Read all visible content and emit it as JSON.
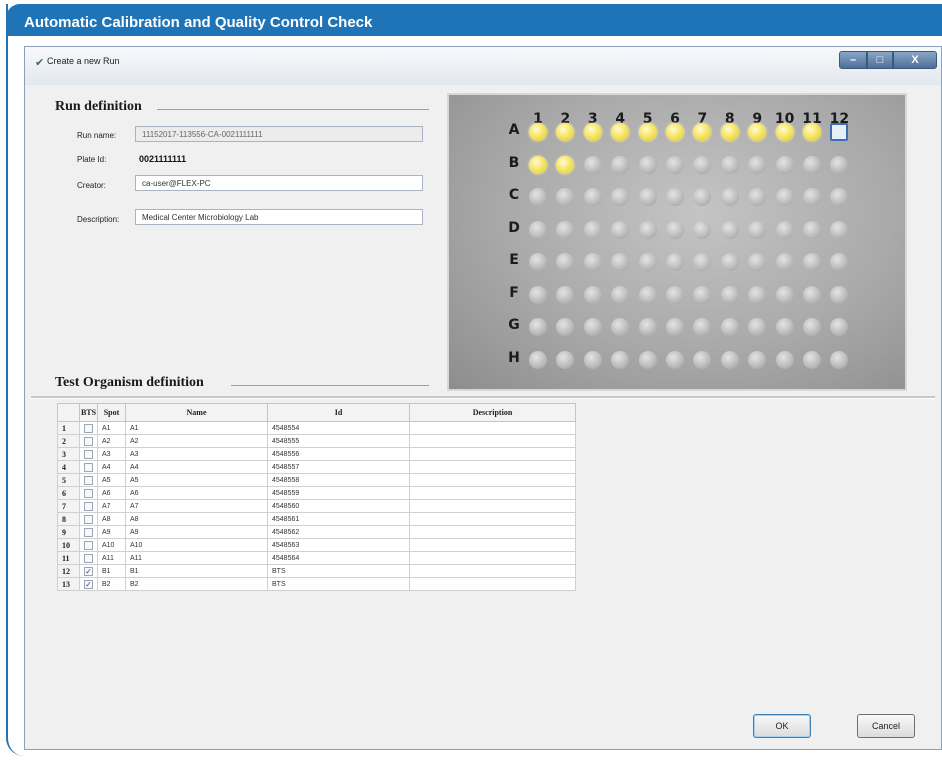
{
  "banner": {
    "title": "Automatic Calibration and Quality Control Check"
  },
  "window": {
    "title": "Create a new Run",
    "controls": {
      "minimize": "–",
      "maximize": "□",
      "close": "X"
    }
  },
  "run_definition": {
    "heading": "Run definition",
    "run_name_label": "Run name:",
    "run_name_value": "11152017-113556-CA-0021111111",
    "plate_id_label": "Plate Id:",
    "plate_id_value": "0021111111",
    "creator_label": "Creator:",
    "creator_value": "ca-user@FLEX-PC",
    "description_label": "Description:",
    "description_value": "Medical Center Microbiology Lab"
  },
  "plate": {
    "columns": [
      "1",
      "2",
      "3",
      "4",
      "5",
      "6",
      "7",
      "8",
      "9",
      "10",
      "11",
      "12"
    ],
    "rows": [
      "A",
      "B",
      "C",
      "D",
      "E",
      "F",
      "G",
      "H"
    ],
    "filled_wells": [
      "A1",
      "A2",
      "A3",
      "A4",
      "A5",
      "A6",
      "A7",
      "A8",
      "A9",
      "A10",
      "A11",
      "B1",
      "B2"
    ],
    "selected_well": "A12",
    "filled_color": "#f6e66a"
  },
  "organism_definition": {
    "heading": "Test Organism definition",
    "columns": {
      "bts": "BTS",
      "spot": "Spot",
      "name": "Name",
      "id": "Id",
      "description": "Description"
    },
    "rows": [
      {
        "num": "1",
        "bts": false,
        "spot": "A1",
        "name": "A1",
        "id": "4548554",
        "description": ""
      },
      {
        "num": "2",
        "bts": false,
        "spot": "A2",
        "name": "A2",
        "id": "4548555",
        "description": ""
      },
      {
        "num": "3",
        "bts": false,
        "spot": "A3",
        "name": "A3",
        "id": "4548556",
        "description": ""
      },
      {
        "num": "4",
        "bts": false,
        "spot": "A4",
        "name": "A4",
        "id": "4548557",
        "description": ""
      },
      {
        "num": "5",
        "bts": false,
        "spot": "A5",
        "name": "A5",
        "id": "4548558",
        "description": ""
      },
      {
        "num": "6",
        "bts": false,
        "spot": "A6",
        "name": "A6",
        "id": "4548559",
        "description": ""
      },
      {
        "num": "7",
        "bts": false,
        "spot": "A7",
        "name": "A7",
        "id": "4548560",
        "description": ""
      },
      {
        "num": "8",
        "bts": false,
        "spot": "A8",
        "name": "A8",
        "id": "4548561",
        "description": ""
      },
      {
        "num": "9",
        "bts": false,
        "spot": "A9",
        "name": "A9",
        "id": "4548562",
        "description": ""
      },
      {
        "num": "10",
        "bts": false,
        "spot": "A10",
        "name": "A10",
        "id": "4548563",
        "description": ""
      },
      {
        "num": "11",
        "bts": false,
        "spot": "A11",
        "name": "A11",
        "id": "4548564",
        "description": ""
      },
      {
        "num": "12",
        "bts": true,
        "spot": "B1",
        "name": "B1",
        "id": "BTS",
        "description": ""
      },
      {
        "num": "13",
        "bts": true,
        "spot": "B2",
        "name": "B2",
        "id": "BTS",
        "description": ""
      }
    ]
  },
  "buttons": {
    "ok": "OK",
    "cancel": "Cancel"
  },
  "colors": {
    "banner": "#1f74b8",
    "accent": "#3b6fb0"
  }
}
